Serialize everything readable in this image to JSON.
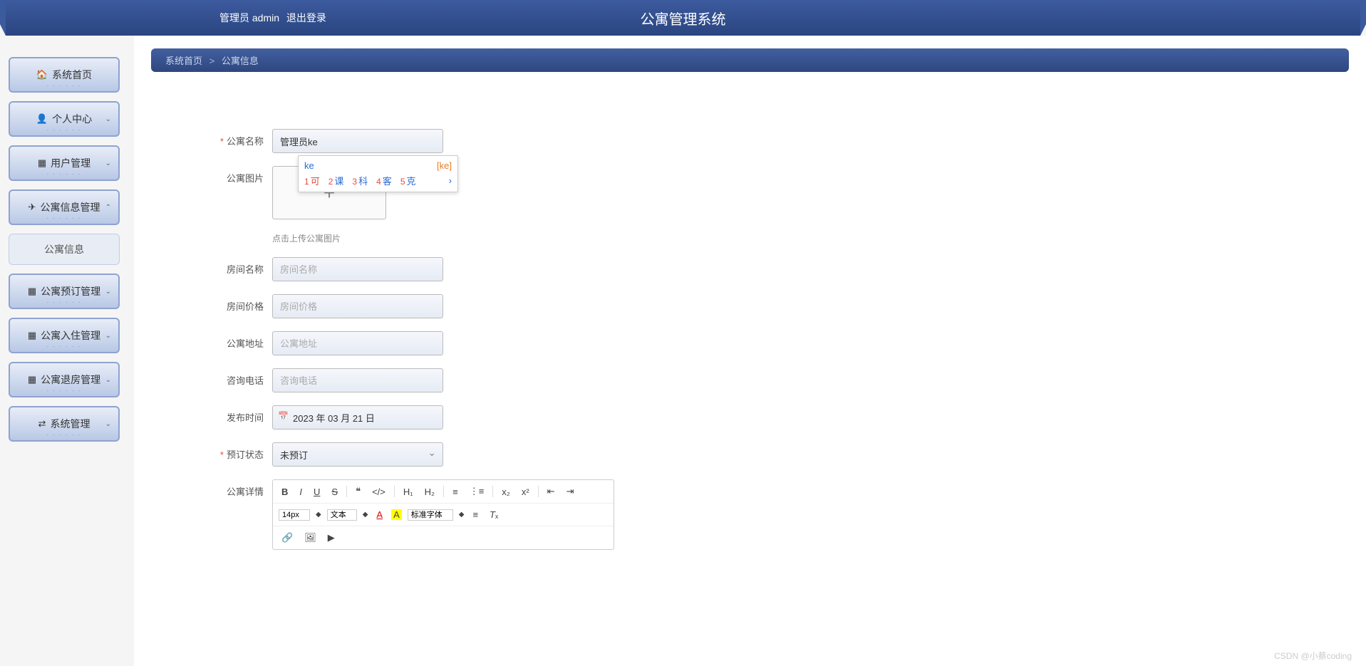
{
  "header": {
    "admin_label": "管理员 admin",
    "logout_label": "退出登录",
    "title": "公寓管理系统"
  },
  "sidebar": {
    "items": [
      {
        "icon": "🏠",
        "label": "系统首页",
        "expandable": false
      },
      {
        "icon": "👤",
        "label": "个人中心",
        "expandable": true
      },
      {
        "icon": "▦",
        "label": "用户管理",
        "expandable": true
      },
      {
        "icon": "✈",
        "label": "公寓信息管理",
        "expandable": true,
        "open": true
      },
      {
        "icon": "",
        "label": "公寓信息",
        "sub": true
      },
      {
        "icon": "▦",
        "label": "公寓预订管理",
        "expandable": true
      },
      {
        "icon": "▦",
        "label": "公寓入住管理",
        "expandable": true
      },
      {
        "icon": "▦",
        "label": "公寓退房管理",
        "expandable": true
      },
      {
        "icon": "⇄",
        "label": "系统管理",
        "expandable": true
      }
    ]
  },
  "breadcrumb": {
    "root": "系统首页",
    "sep": ">",
    "current": "公寓信息"
  },
  "form": {
    "apt_name": {
      "label": "公寓名称",
      "value": "管理员ke"
    },
    "apt_image": {
      "label": "公寓图片",
      "hint": "点击上传公寓图片"
    },
    "room_name": {
      "label": "房间名称",
      "placeholder": "房间名称"
    },
    "room_price": {
      "label": "房间价格",
      "placeholder": "房间价格"
    },
    "apt_addr": {
      "label": "公寓地址",
      "placeholder": "公寓地址"
    },
    "phone": {
      "label": "咨询电话",
      "placeholder": "咨询电话"
    },
    "pub_date": {
      "label": "发布时间",
      "value": "2023 年 03 月 21 日"
    },
    "book_status": {
      "label": "预订状态",
      "value": "未预订"
    },
    "detail": {
      "label": "公寓详情"
    }
  },
  "editor": {
    "font_size": "14px",
    "font_type": "文本",
    "font_family": "标准字体"
  },
  "ime": {
    "typed": "ke",
    "phonetic": "[ke]",
    "candidates": [
      {
        "n": "1",
        "ch": "可"
      },
      {
        "n": "2",
        "ch": "课"
      },
      {
        "n": "3",
        "ch": "科"
      },
      {
        "n": "4",
        "ch": "客"
      },
      {
        "n": "5",
        "ch": "克"
      }
    ]
  },
  "watermark": "CSDN @小蔡coding"
}
